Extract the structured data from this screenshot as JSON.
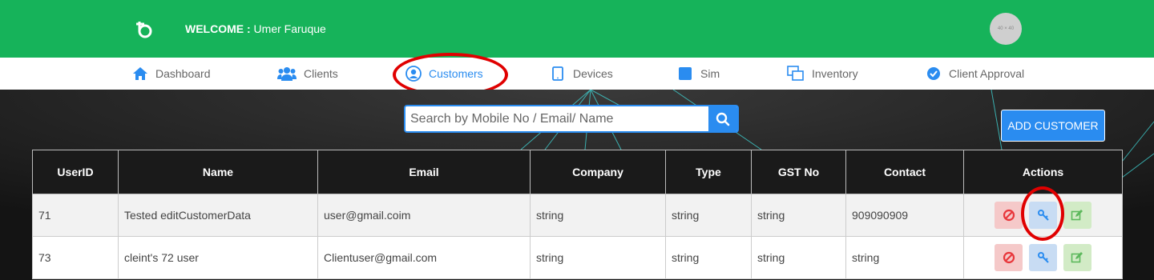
{
  "header": {
    "welcome_label": "WELCOME :",
    "user_name": "Umer Faruque",
    "avatar_text": "40 × 40",
    "logo_icon": "brand-logo-icon"
  },
  "nav": {
    "items": [
      {
        "label": "Dashboard",
        "icon": "home-icon"
      },
      {
        "label": "Clients",
        "icon": "users-icon"
      },
      {
        "label": "Customers",
        "icon": "user-circle-icon",
        "active": true
      },
      {
        "label": "Devices",
        "icon": "tablet-icon"
      },
      {
        "label": "Sim",
        "icon": "sim-square-icon"
      },
      {
        "label": "Inventory",
        "icon": "inventory-icon"
      },
      {
        "label": "Client Approval",
        "icon": "check-circle-icon"
      }
    ]
  },
  "search": {
    "placeholder": "Search by Mobile No / Email/ Name",
    "value": ""
  },
  "add_customer_label": "ADD CUSTOMER",
  "table": {
    "headers": [
      "UserID",
      "Name",
      "Email",
      "Company",
      "Type",
      "GST No",
      "Contact",
      "Actions"
    ],
    "rows": [
      [
        "71",
        "Tested editCustomerData",
        "user@gmail.coim",
        "string",
        "string",
        "string",
        "909090909"
      ],
      [
        "73",
        "cleint's 72 user",
        "Clientuser@gmail.com",
        "string",
        "string",
        "string",
        "string"
      ]
    ]
  },
  "colors": {
    "header_green": "#16b35a",
    "accent_blue": "#2a8cf0",
    "highlight_red": "#e00000"
  }
}
